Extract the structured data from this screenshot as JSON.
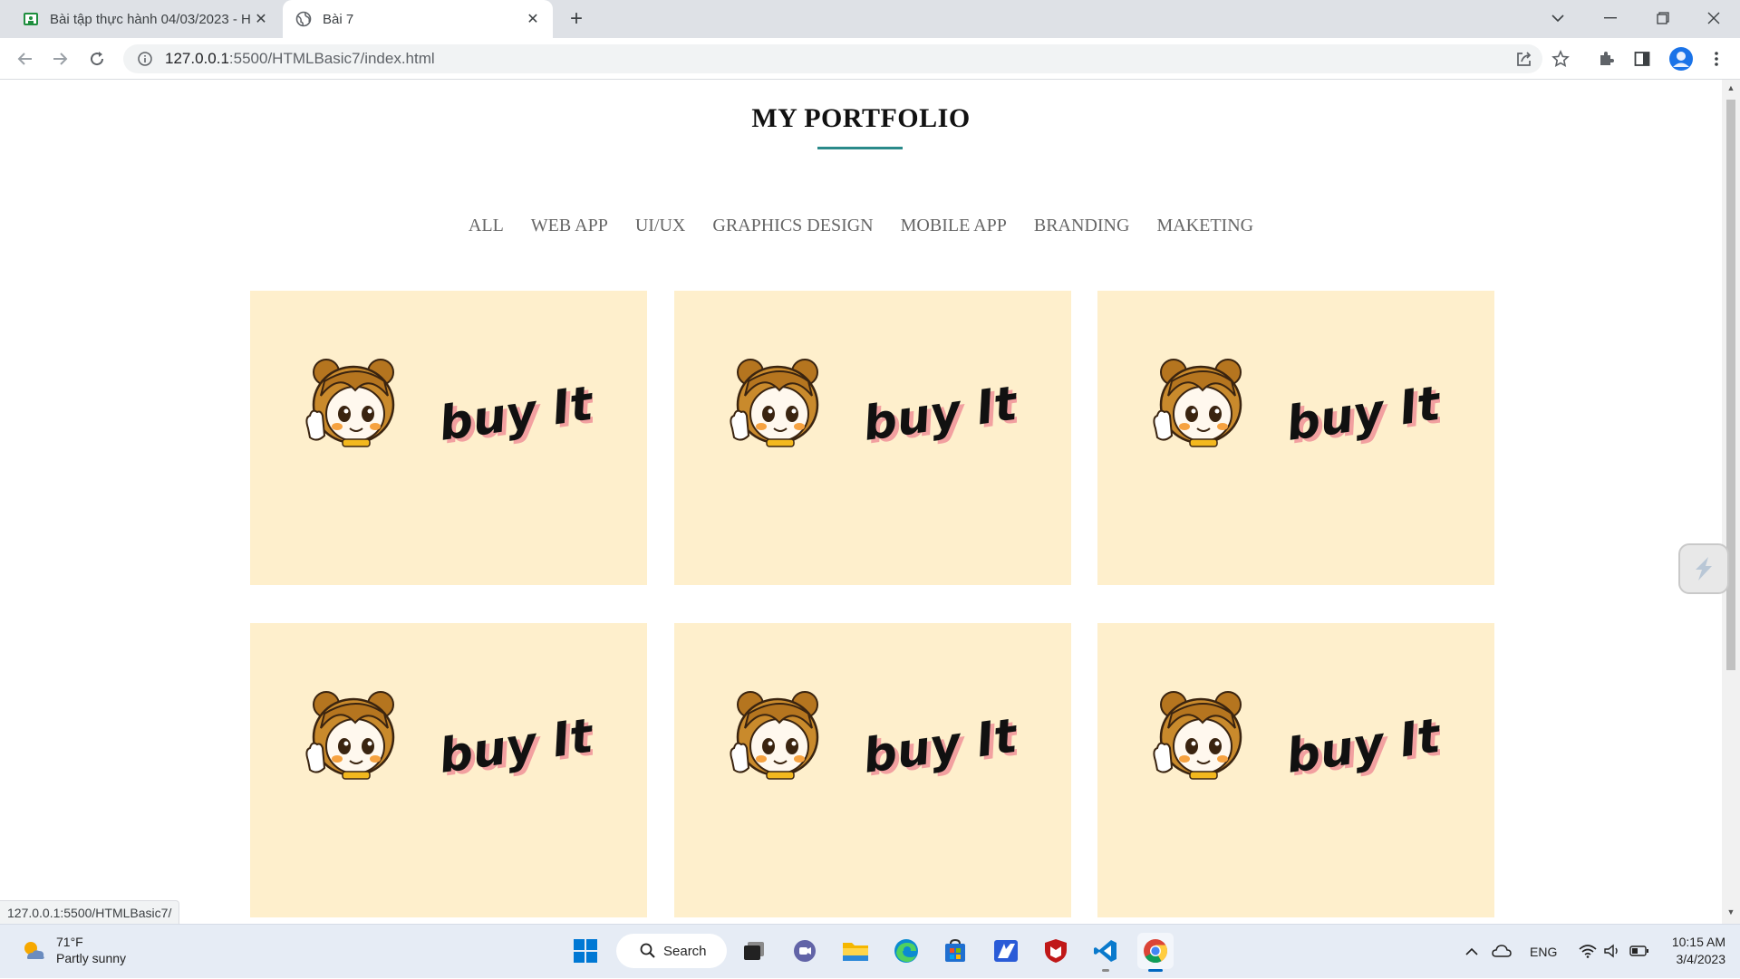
{
  "browser": {
    "tabs": [
      {
        "title": "Bài tập thực hành 04/03/2023 - H",
        "active": false,
        "icon": "classroom-icon"
      },
      {
        "title": "Bài 7",
        "active": true,
        "icon": "globe-icon"
      }
    ],
    "close_glyph": "✕",
    "new_tab_glyph": "+",
    "url_host": "127.0.0.1",
    "url_path": ":5500/HTMLBasic7/index.html",
    "status_url": "127.0.0.1:5500/HTMLBasic7/"
  },
  "page": {
    "title": "MY PORTFOLIO",
    "accent_color": "#2a8a8a",
    "card_color": "#feefcc",
    "filters": [
      "ALL",
      "WEB APP",
      "UI/UX",
      "GRAPHICS DESIGN",
      "MOBILE APP",
      "BRANDING",
      "MAKETING"
    ],
    "card_text": "buy It!",
    "card_count": 6
  },
  "taskbar": {
    "weather_temp": "71°F",
    "weather_desc": "Partly sunny",
    "search_label": "Search",
    "language": "ENG",
    "time": "10:15 AM",
    "date": "3/4/2023"
  }
}
